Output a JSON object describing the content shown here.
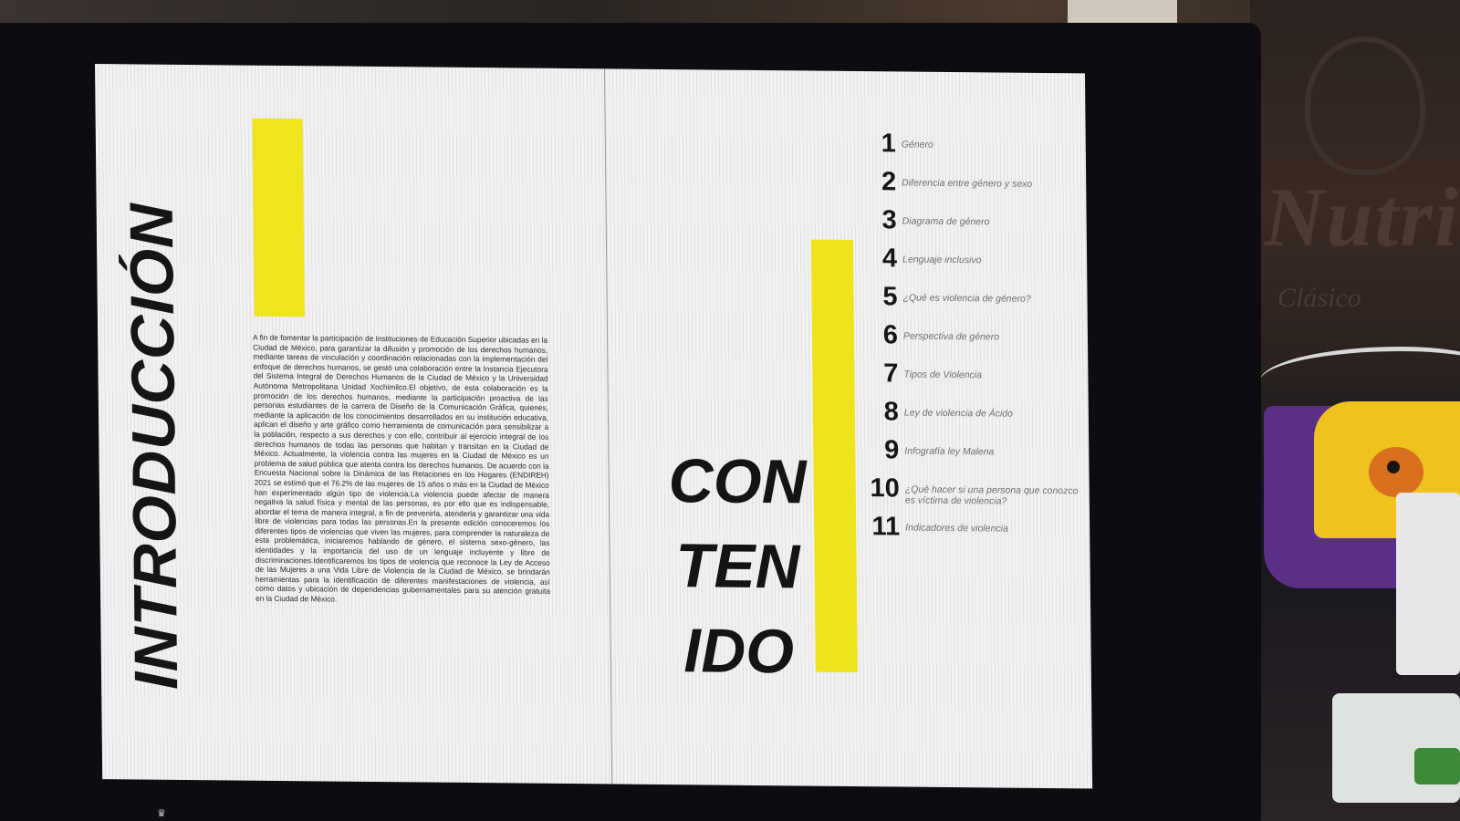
{
  "spread": {
    "intro": {
      "title": "INTRODUCCIÓN",
      "body": "A fin de fomentar la participación de Instituciones de Educación Superior ubicadas en la Ciudad de México, para garantizar la difusión y promoción de los derechos humanos, mediante tareas de vinculación y coordinación relacionadas con la implementación del enfoque de derechos humanos, se gestó una colaboración entre la Instancia Ejecutora del Sistema Integral de Derechos Humanos de la Ciudad de México y la Universidad Autónoma Metropolitana Unidad Xochimilco.El objetivo, de esta colaboración es la promoción de los derechos humanos, mediante la participación proactiva de las personas estudiantes de la carrera de Diseño de la Comunicación Gráfica, quienes, mediante la aplicación de los conocimientos desarrollados en su institución educativa, aplican el diseño y arte gráfico como herramienta de comunicación para sensibilizar a la población, respecto a sus derechos y con ello, contribuir al ejercicio integral de los derechos humanos de todas las personas que habitan y transitan en la Ciudad de México. Actualmente, la violencia contra las mujeres en la Ciudad de México es un problema de salud pública que atenta contra los derechos humanos. De acuerdo con la Encuesta Nacional sobre la Dinámica de las Relaciones en los Hogares (ENDIREH) 2021 se estimó que el 76.2% de las mujeres de 15 años o más en la Ciudad de México han experimentado algún tipo de violencia.La violencia puede afectar de manera negativa la salud física y mental de las personas, es por ello que es indispensable, abordar el tema de manera integral, a fin de prevenirla, atenderla y garantizar una vida libre de violencias para todas las personas.En la presente edición conoceremos los diferentes tipos de violencias que viven las mujeres, para comprender la naturaleza de esta problemática, iniciaremos hablando de género, el sistema sexo-género, las identidades y la importancia del uso de un lenguaje incluyente y libre de discriminaciones.Identificaremos los tipos de violencia que reconoce la Ley de Acceso de las Mujeres a una Vida Libre de Violencia de la Ciudad de México, se brindarán herramientas para la identificación de diferentes manifestaciones de violencia, así como datos y ubicación de dependencias gubernamentales para su atención gratuita en la Ciudad de México."
    },
    "contents": {
      "title_lines": [
        "CON",
        "TEN",
        "IDO"
      ],
      "items": [
        {
          "num": "1",
          "label": "Género"
        },
        {
          "num": "2",
          "label": "Diferencia entre género y sexo"
        },
        {
          "num": "3",
          "label": "Diagrama de género"
        },
        {
          "num": "4",
          "label": "Lenguaje inclusivo"
        },
        {
          "num": "5",
          "label": "¿Qué es violencia de género?"
        },
        {
          "num": "6",
          "label": "Perspectiva de género"
        },
        {
          "num": "7",
          "label": "Tipos de Violencia"
        },
        {
          "num": "8",
          "label": "Ley de violencia de Ácido"
        },
        {
          "num": "9",
          "label": "Infografía ley Malena"
        },
        {
          "num": "10",
          "label": "¿Qué hacer si una persona que conozco es víctima de violencia?"
        },
        {
          "num": "11",
          "label": "Indicadores de violencia"
        }
      ]
    },
    "accent_color": "#f0e41c"
  },
  "background": {
    "bag_label": "Nutri",
    "bag_sub": "Clásico"
  }
}
